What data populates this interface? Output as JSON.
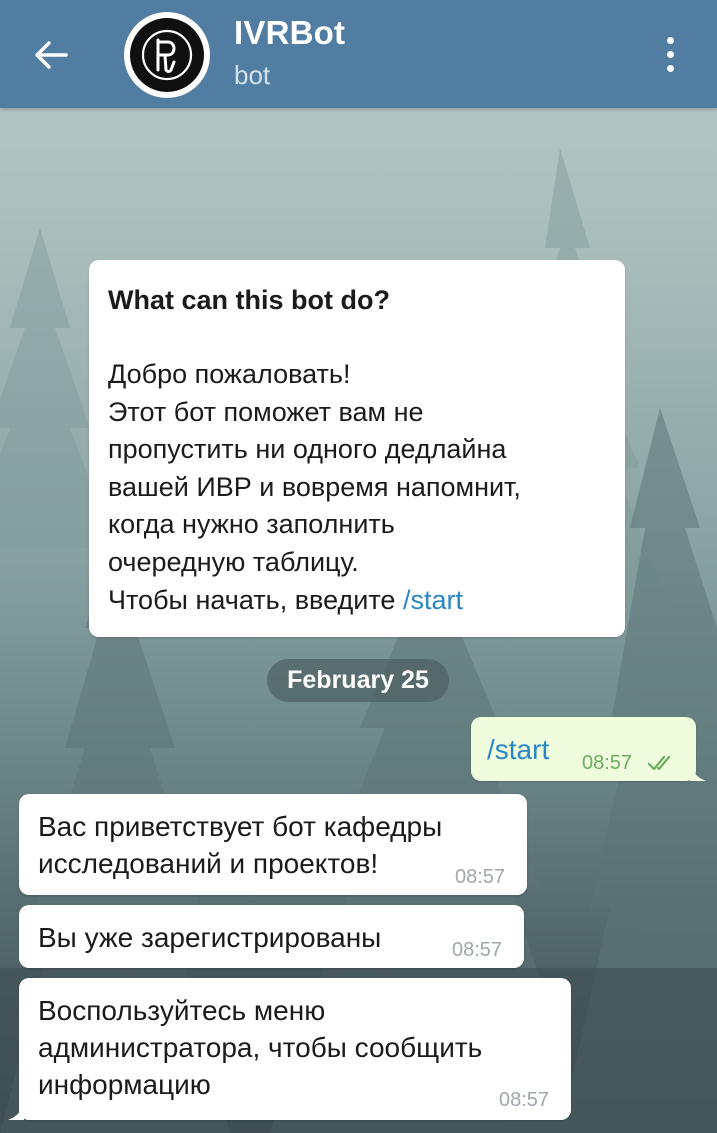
{
  "header": {
    "title": "IVRBot",
    "subtitle": "bot",
    "accent_color": "#517da2",
    "icons": [
      "back-arrow-icon",
      "bot-avatar",
      "more-vert-icon"
    ]
  },
  "info_card": {
    "title": "What can this bot do?",
    "lines": [
      "Добро пожаловать!",
      "Этот бот поможет вам не",
      "пропустить ни одного дедлайна",
      "вашей ИВР и вовремя напомнит,",
      "когда нужно заполнить",
      "очередную таблицу."
    ],
    "last_line_prefix": "Чтобы начать, введите ",
    "last_line_command": "/start"
  },
  "date_separator": "February 25",
  "messages": [
    {
      "direction": "out",
      "text": "/start",
      "time": "08:57",
      "status": "read"
    },
    {
      "direction": "in",
      "lines": [
        "Вас приветствует бот кафедры",
        "исследований и проектов!"
      ],
      "time": "08:57"
    },
    {
      "direction": "in",
      "lines": [
        "Вы уже зарегистрированы"
      ],
      "time": "08:57"
    },
    {
      "direction": "in",
      "lines": [
        "Воспользуйтесь меню",
        "администратора, чтобы сообщить",
        "информацию"
      ],
      "time": "08:57"
    }
  ]
}
